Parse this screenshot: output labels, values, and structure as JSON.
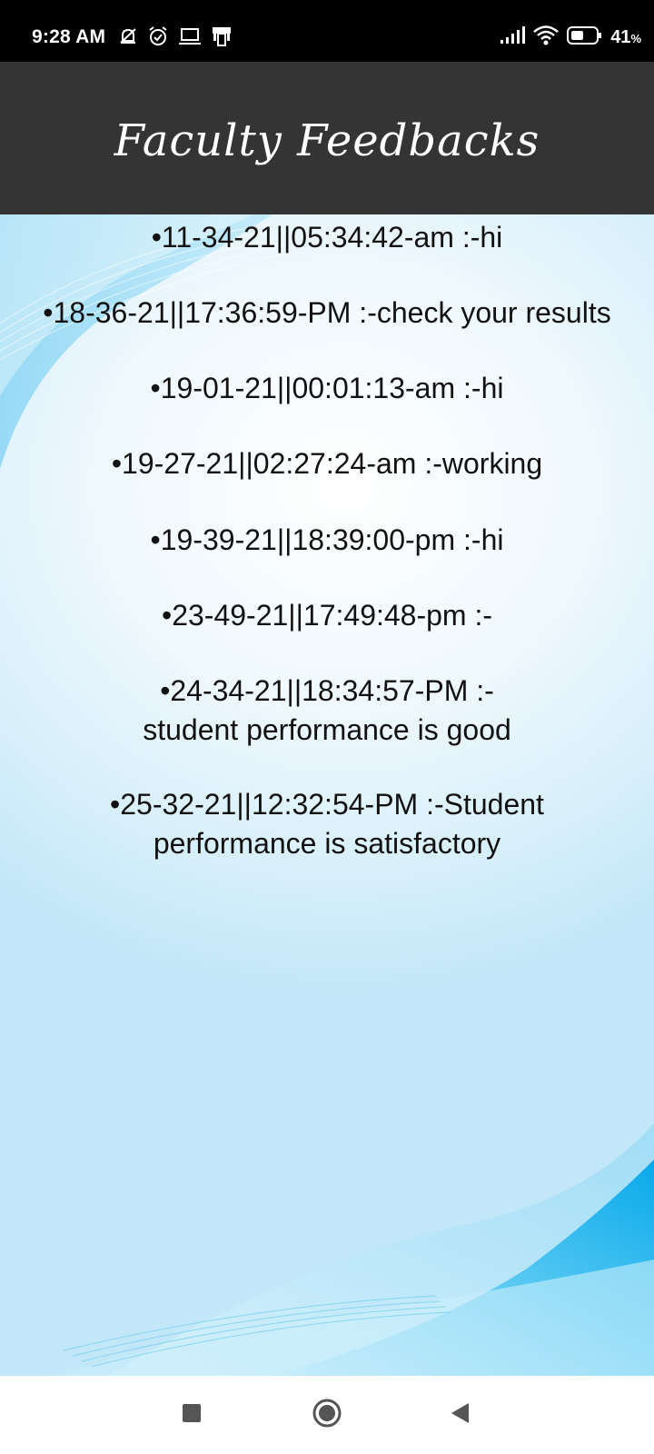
{
  "status_bar": {
    "time": "9:28 AM",
    "left_icons": [
      "mute-bell-icon",
      "alarm-icon",
      "laptop-icon",
      "phone-link-icon"
    ],
    "right_icons": [
      "signal-icon",
      "wifi-icon",
      "battery-icon"
    ],
    "battery_percent": "41",
    "battery_unit": "%"
  },
  "header": {
    "title": "Faculty Feedbacks"
  },
  "feedbacks": [
    "•11-34-21||05:34:42-am :-hi",
    "•18-36-21||17:36:59-PM :-check your results",
    "•19-01-21||00:01:13-am :-hi",
    "•19-27-21||02:27:24-am :-working",
    "•19-39-21||18:39:00-pm :-hi",
    "•23-49-21||17:49:48-pm :-",
    "•24-34-21||18:34:57-PM :-student performance is good",
    "•25-32-21||12:32:54-PM :-Student performance is satisfactory"
  ],
  "nav_bar": {
    "buttons": [
      "recents-square-icon",
      "home-circle-icon",
      "back-triangle-icon"
    ]
  },
  "colors": {
    "status_bar_bg": "#000000",
    "header_bg": "#343434",
    "accent_blue": "#1ea7e4",
    "text": "#111111"
  }
}
